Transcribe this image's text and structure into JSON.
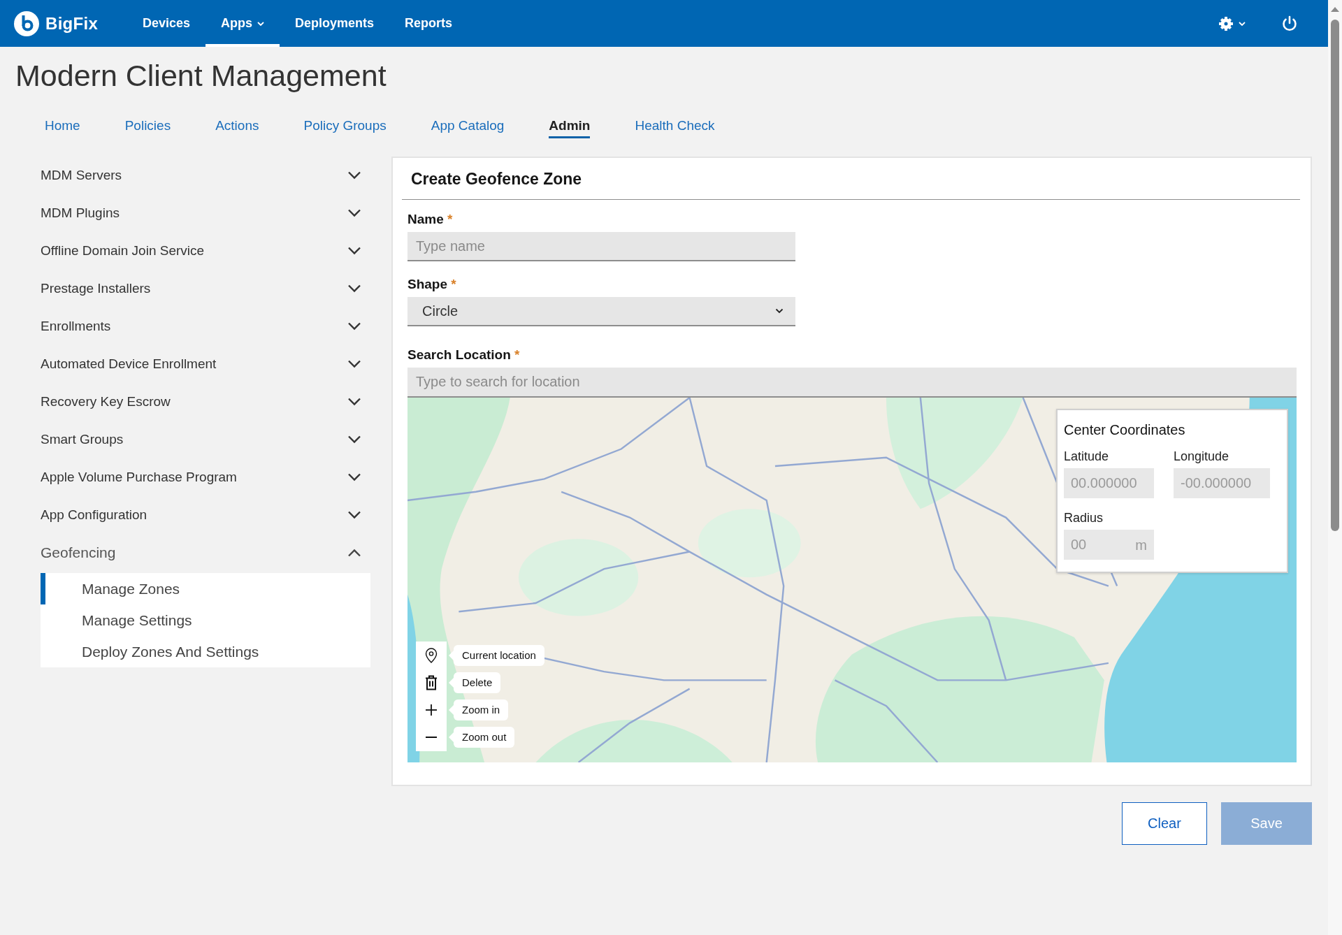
{
  "header": {
    "logo": "BigFix",
    "nav": [
      {
        "label": "Devices",
        "selected": false,
        "has_menu": false
      },
      {
        "label": "Apps",
        "selected": true,
        "has_menu": true
      },
      {
        "label": "Deployments",
        "selected": false,
        "has_menu": false
      },
      {
        "label": "Reports",
        "selected": false,
        "has_menu": false
      }
    ]
  },
  "page_title": "Modern Client Management",
  "tabs": [
    {
      "label": "Home",
      "selected": false
    },
    {
      "label": "Policies",
      "selected": false
    },
    {
      "label": "Actions",
      "selected": false
    },
    {
      "label": "Policy Groups",
      "selected": false
    },
    {
      "label": "App Catalog",
      "selected": false
    },
    {
      "label": "Admin",
      "selected": true
    },
    {
      "label": "Health Check",
      "selected": false
    }
  ],
  "sidebar": {
    "items": [
      {
        "label": "MDM Servers",
        "expanded": false
      },
      {
        "label": "MDM Plugins",
        "expanded": false
      },
      {
        "label": "Offline Domain Join Service",
        "expanded": false
      },
      {
        "label": "Prestage Installers",
        "expanded": false
      },
      {
        "label": "Enrollments",
        "expanded": false
      },
      {
        "label": "Automated Device Enrollment",
        "expanded": false
      },
      {
        "label": "Recovery Key Escrow",
        "expanded": false
      },
      {
        "label": "Smart Groups",
        "expanded": false
      },
      {
        "label": "Apple Volume Purchase Program",
        "expanded": false
      },
      {
        "label": "App Configuration",
        "expanded": false
      },
      {
        "label": "Geofencing",
        "expanded": true,
        "children": [
          {
            "label": "Manage Zones",
            "selected": true
          },
          {
            "label": "Manage Settings",
            "selected": false
          },
          {
            "label": "Deploy Zones And Settings",
            "selected": false
          }
        ]
      }
    ]
  },
  "form": {
    "title": "Create Geofence Zone",
    "fields": [
      {
        "kind": "text",
        "label": "Name",
        "required_mark": "*",
        "placeholder": "Type name"
      },
      {
        "kind": "select",
        "label": "Shape",
        "required_mark": "*",
        "value": "Circle"
      },
      {
        "kind": "search",
        "label": "Search Location",
        "required_mark": "*",
        "placeholder": "Type to search for location"
      }
    ],
    "map": {
      "tools": [
        {
          "kind": "location",
          "tooltip": "Current location"
        },
        {
          "kind": "delete",
          "tooltip": "Delete"
        },
        {
          "kind": "zoom_in",
          "tooltip": "Zoom in"
        },
        {
          "kind": "zoom_out",
          "tooltip": "Zoom out"
        }
      ],
      "coordinates": {
        "title": "Center Coordinates",
        "latitude": {
          "label": "Latitude",
          "placeholder": "00.000000"
        },
        "longitude": {
          "label": "Longitude",
          "placeholder": "-00.000000"
        },
        "radius": {
          "label": "Radius",
          "placeholder": "00",
          "unit": "m"
        }
      }
    }
  },
  "buttons": [
    {
      "kind": "outline",
      "label": "Clear",
      "disabled": false
    },
    {
      "kind": "primary",
      "label": "Save",
      "disabled": true
    }
  ]
}
